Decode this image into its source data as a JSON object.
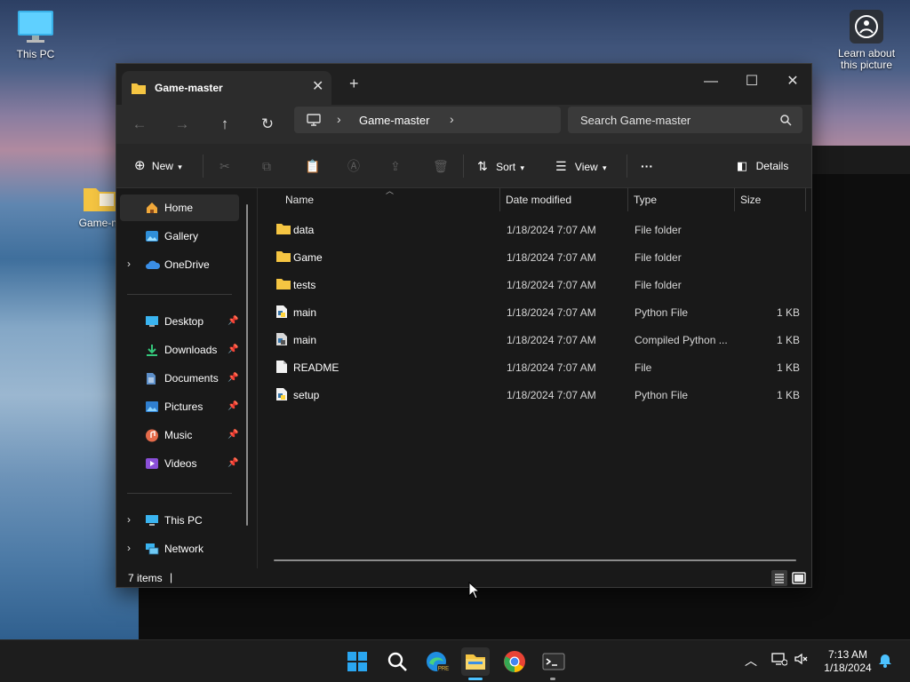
{
  "desktop": {
    "icons": [
      {
        "label": "This PC",
        "icon": "monitor-icon"
      },
      {
        "label": "Game-m",
        "icon": "folder-icon"
      },
      {
        "label": "Learn about this picture",
        "icon": "camera-icon"
      }
    ]
  },
  "window": {
    "tab_title": "Game-master",
    "breadcrumb": {
      "root_icon": "monitor-icon",
      "current": "Game-master"
    },
    "search_placeholder": "Search Game-master",
    "toolbar": {
      "new_label": "New",
      "sort_label": "Sort",
      "view_label": "View",
      "more_label": "···",
      "details_label": "Details"
    },
    "sidebar": {
      "items": [
        {
          "label": "Home",
          "icon": "home-icon",
          "selected": true
        },
        {
          "label": "Gallery",
          "icon": "gallery-icon"
        },
        {
          "label": "OneDrive",
          "icon": "cloud-icon",
          "expandable": true
        },
        {
          "label": "Desktop",
          "icon": "desktop-icon",
          "pinned": true
        },
        {
          "label": "Downloads",
          "icon": "download-icon",
          "pinned": true
        },
        {
          "label": "Documents",
          "icon": "document-icon",
          "pinned": true
        },
        {
          "label": "Pictures",
          "icon": "picture-icon",
          "pinned": true
        },
        {
          "label": "Music",
          "icon": "music-icon",
          "pinned": true
        },
        {
          "label": "Videos",
          "icon": "video-icon",
          "pinned": true
        },
        {
          "label": "This PC",
          "icon": "monitor-icon",
          "expandable": true
        },
        {
          "label": "Network",
          "icon": "network-icon",
          "expandable": true
        }
      ]
    },
    "columns": {
      "name": "Name",
      "date": "Date modified",
      "type": "Type",
      "size": "Size"
    },
    "files": [
      {
        "name": "data",
        "date": "1/18/2024 7:07 AM",
        "type": "File folder",
        "size": "",
        "icon": "folder-icon"
      },
      {
        "name": "Game",
        "date": "1/18/2024 7:07 AM",
        "type": "File folder",
        "size": "",
        "icon": "folder-icon"
      },
      {
        "name": "tests",
        "date": "1/18/2024 7:07 AM",
        "type": "File folder",
        "size": "",
        "icon": "folder-icon"
      },
      {
        "name": "main",
        "date": "1/18/2024 7:07 AM",
        "type": "Python File",
        "size": "1 KB",
        "icon": "python-file-icon"
      },
      {
        "name": "main",
        "date": "1/18/2024 7:07 AM",
        "type": "Compiled Python ...",
        "size": "1 KB",
        "icon": "compiled-python-icon"
      },
      {
        "name": "README",
        "date": "1/18/2024 7:07 AM",
        "type": "File",
        "size": "1 KB",
        "icon": "file-icon"
      },
      {
        "name": "setup",
        "date": "1/18/2024 7:07 AM",
        "type": "Python File",
        "size": "1 KB",
        "icon": "python-file-icon"
      }
    ],
    "status": {
      "item_count": "7 items"
    }
  },
  "taskbar": {
    "apps": [
      "windows-start-icon",
      "search-icon",
      "edge-icon",
      "file-explorer-icon",
      "chrome-icon",
      "terminal-icon"
    ],
    "clock": {
      "time": "7:13 AM",
      "date": "1/18/2024"
    }
  },
  "colors": {
    "accent": "#4cc2ff",
    "folder": "#f5c542",
    "window_bg": "#191919"
  }
}
